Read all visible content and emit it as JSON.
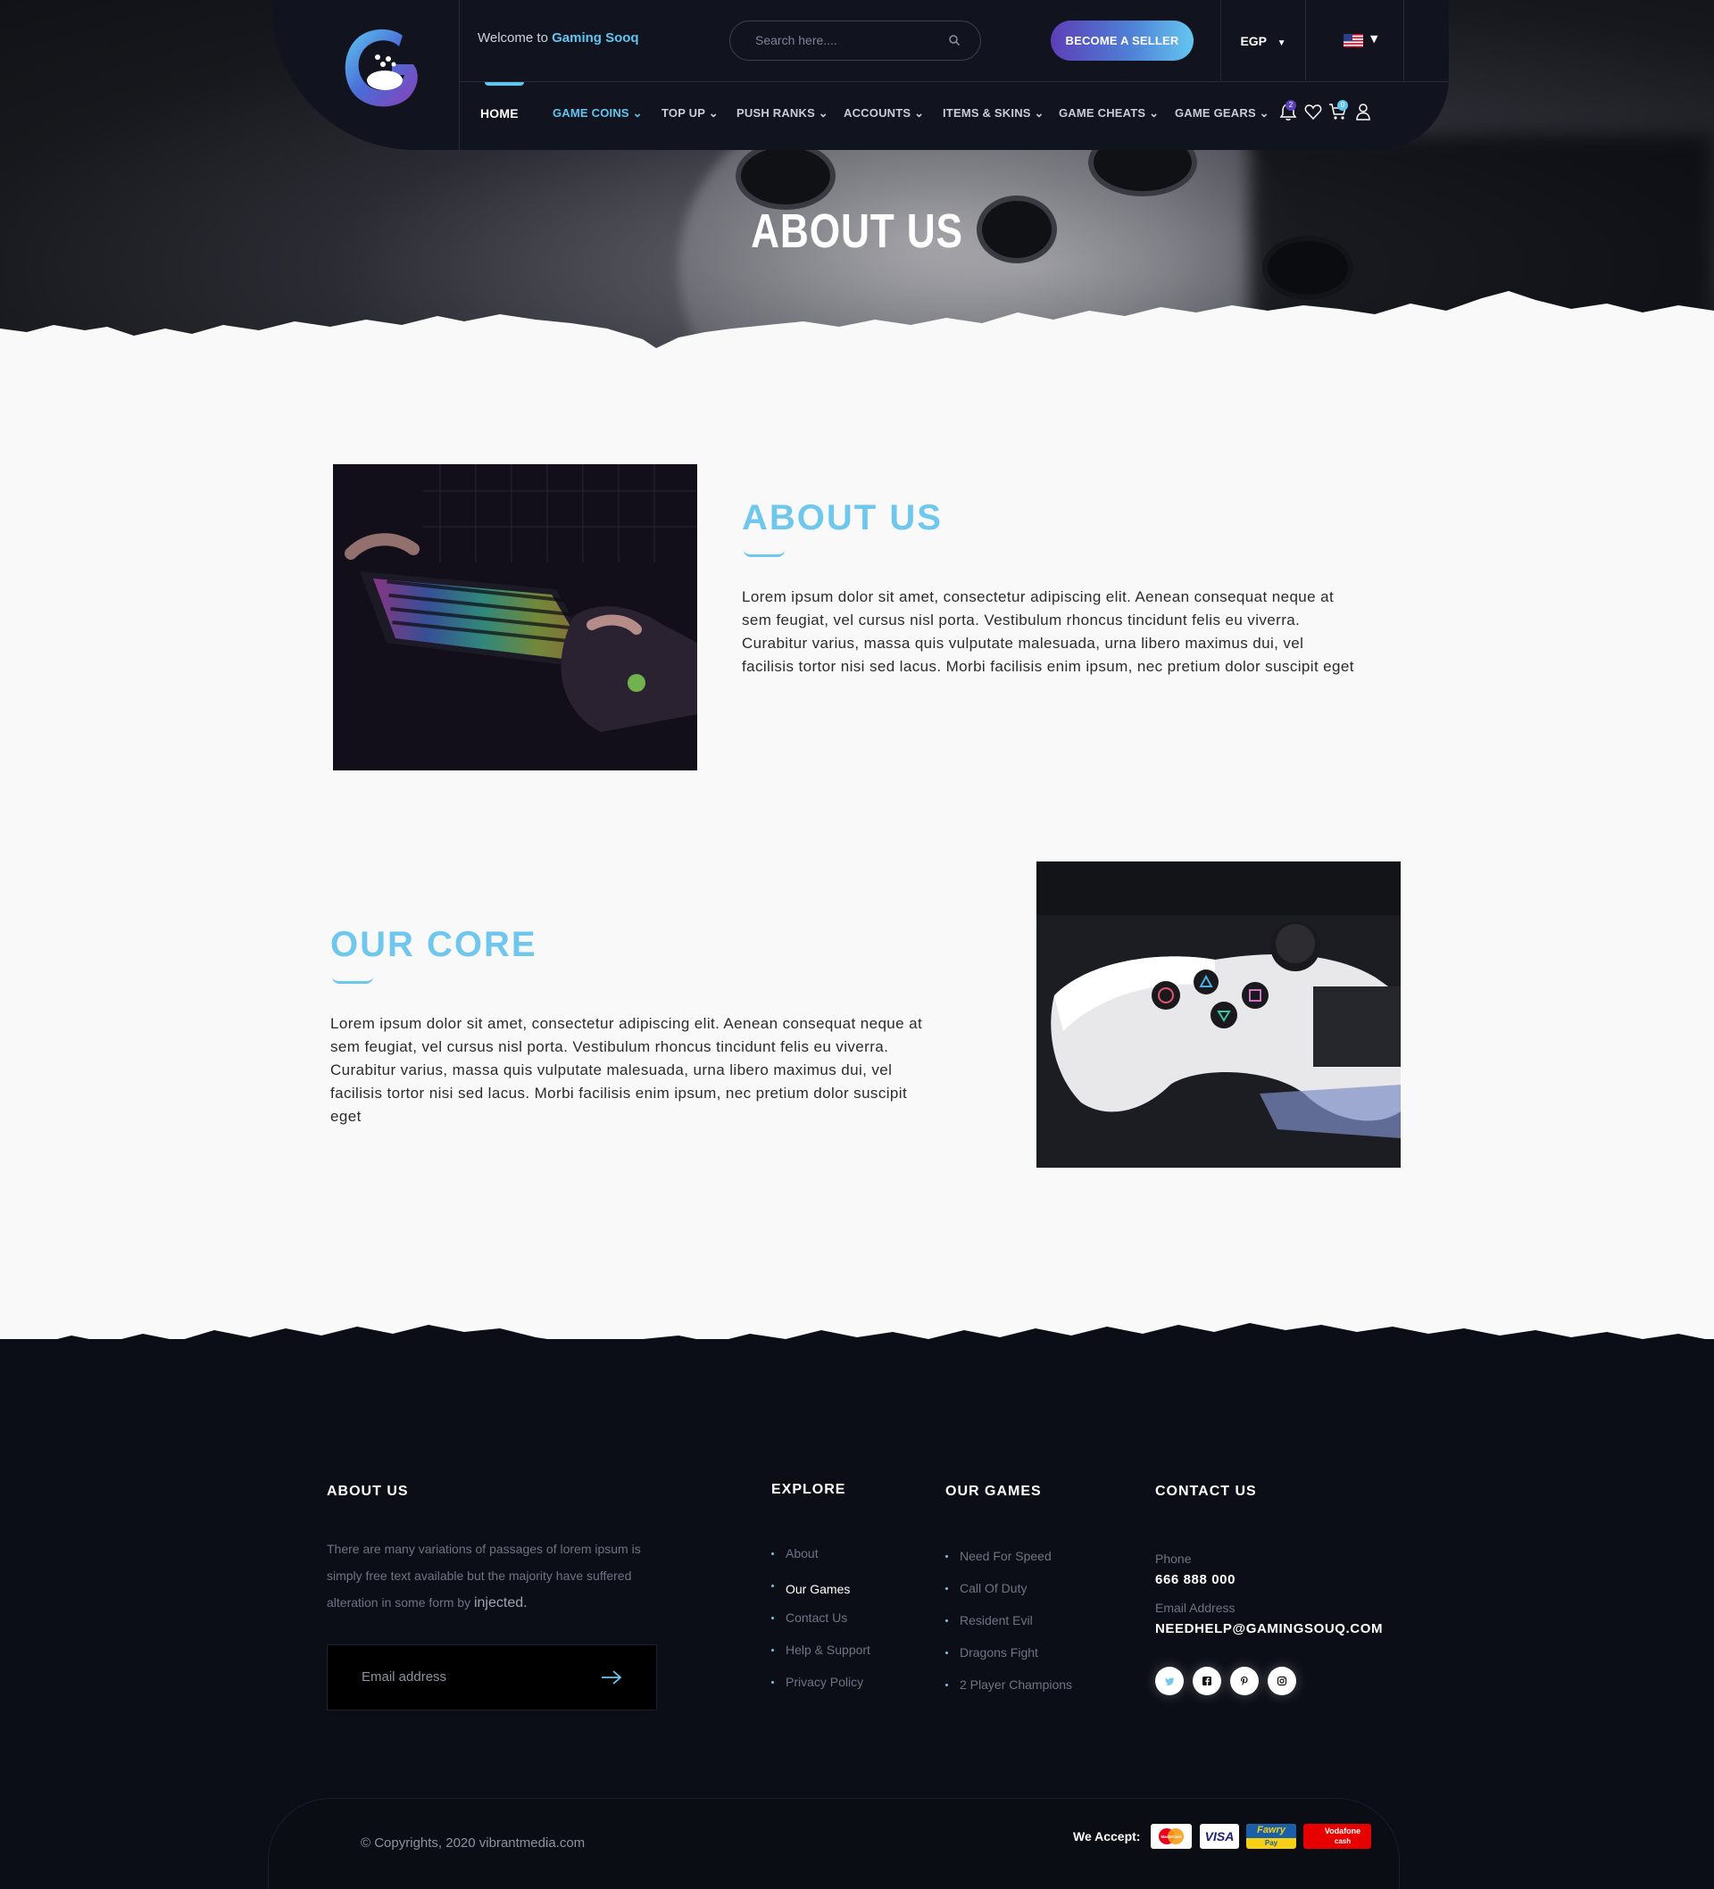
{
  "header": {
    "welcome_prefix": "Welcome to",
    "welcome_brand": "Gaming Sooq",
    "search_placeholder": "Search here....",
    "seller_button": "BECOME A SELLER",
    "currency": "EGP",
    "notification_count": "2",
    "cart_count": "0",
    "nav": [
      {
        "label": "HOME"
      },
      {
        "label": "GAME COINS"
      },
      {
        "label": "TOP UP"
      },
      {
        "label": "PUSH RANKS"
      },
      {
        "label": "ACCOUNTS"
      },
      {
        "label": "ITEMS & SKINS"
      },
      {
        "label": "GAME CHEATS"
      },
      {
        "label": "GAME GEARS"
      }
    ]
  },
  "hero": {
    "title": "ABOUT US"
  },
  "about": {
    "title": "ABOUT US",
    "text": "Lorem ipsum dolor sit amet, consectetur adipiscing elit. Aenean consequat neque at sem feugiat, vel cursus nisl porta. Vestibulum rhoncus tincidunt felis eu viverra. Curabitur varius, massa quis vulputate malesuada, urna libero maximus dui, vel facilisis tortor nisi sed lacus. Morbi facilisis enim ipsum, nec pretium dolor suscipit eget"
  },
  "core": {
    "title": "OUR CORE",
    "text": "Lorem ipsum dolor sit amet, consectetur adipiscing elit. Aenean consequat neque at sem feugiat, vel cursus nisl porta. Vestibulum rhoncus tincidunt felis eu viverra. Curabitur varius, massa quis vulputate malesuada, urna libero maximus dui, vel facilisis tortor nisi sed lacus. Morbi facilisis enim ipsum, nec pretium dolor suscipit eget"
  },
  "footer": {
    "about_heading": "ABOUT US",
    "about_text": "There are many variations of passages of lorem ipsum is simply free text available but the majority have suffered alteration in some form by",
    "about_text_end": "injected.",
    "email_placeholder": "Email address",
    "explore_heading": "EXPLORE",
    "explore": [
      "About",
      "Our Games",
      "Contact Us",
      "Help & Support",
      "Privacy Policy"
    ],
    "games_heading": "OUR GAMES",
    "games": [
      "Need For Speed",
      "Call Of Duty",
      "Resident Evil",
      "Dragons Fight",
      "2 Player Champions"
    ],
    "contact_heading": "CONTACT US",
    "phone_label": "Phone",
    "phone": "666 888 000",
    "email_label": "Email Address",
    "email": "NEEDHELP@GAMINGSOUQ.COM",
    "copyright": "© Copyrights, 2020 vibrantmedia.com",
    "we_accept": "We Accept:",
    "payments": [
      {
        "name": "mastercard",
        "label": "MasterCard"
      },
      {
        "name": "visa",
        "label": "VISA"
      },
      {
        "name": "fawry",
        "label": "Fawry",
        "sub": "Pay"
      },
      {
        "name": "vodafone",
        "label": "Vodafone",
        "sub": "cash"
      }
    ]
  },
  "colors": {
    "accent": "#6fc7ee",
    "header_bg": "#11131f",
    "footer_bg": "#0c0e17",
    "seller_gradient_start": "#5d3fb8",
    "seller_gradient_end": "#64c6f0"
  }
}
